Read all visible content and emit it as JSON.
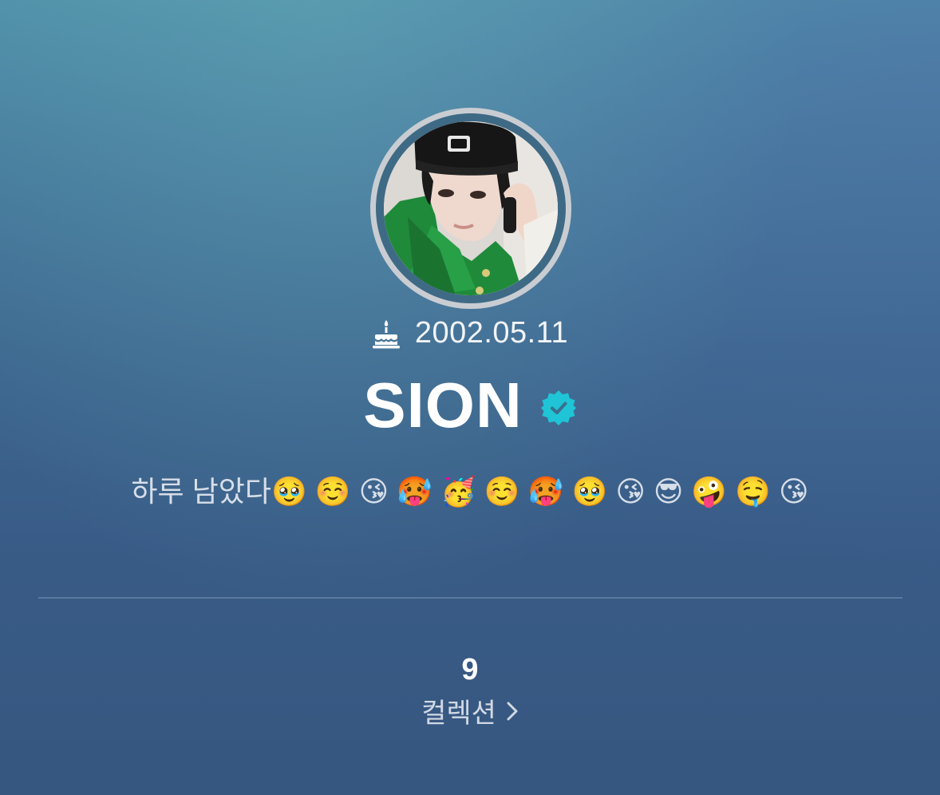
{
  "profile": {
    "birthday": "2002.05.11",
    "name": "SION",
    "status_text": "하루 남았다🥹 ☺️ 😘 🥵 🥳 ☺️ 🥵 🥹 😘 😎 🤪 🤤 😘"
  },
  "collection": {
    "count": "9",
    "label": "컬렉션"
  },
  "icons": {
    "birthday": "cake-icon",
    "verified": "verified-badge-icon",
    "collection_link": "chevron-right-icon"
  },
  "colors": {
    "verified_badge": "#1fc4d6",
    "background_top": "#4f8fa8",
    "background_bottom": "#36577f"
  }
}
